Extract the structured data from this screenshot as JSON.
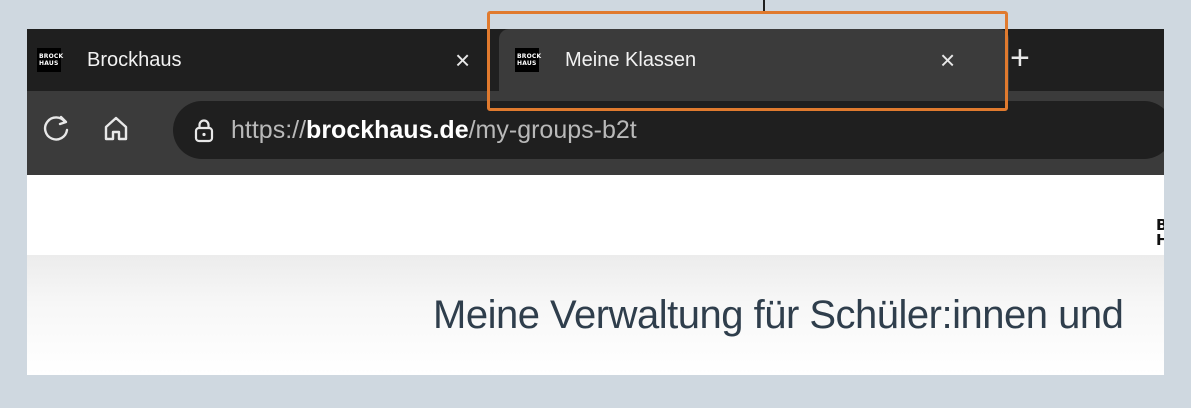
{
  "browser": {
    "tabs": [
      {
        "title": "Brockhaus",
        "favicon": [
          "BROCK",
          "HAUS"
        ],
        "active": false
      },
      {
        "title": "Meine Klassen",
        "favicon": [
          "BROCK",
          "HAUS"
        ],
        "active": true
      }
    ],
    "close_symbol": "×",
    "new_tab_symbol": "+",
    "url": {
      "protocol": "https://",
      "domain": "brockhaus.de",
      "path": "/my-groups-b2t"
    }
  },
  "page": {
    "logo_fragment": [
      "B",
      "H"
    ],
    "title": "Meine Verwaltung für Schüler:innen und"
  },
  "colors": {
    "highlight": "#e07a2e",
    "title": "#2f3e4c",
    "chrome_dark": "#1f1f1f",
    "chrome_active": "#3b3b3b"
  }
}
